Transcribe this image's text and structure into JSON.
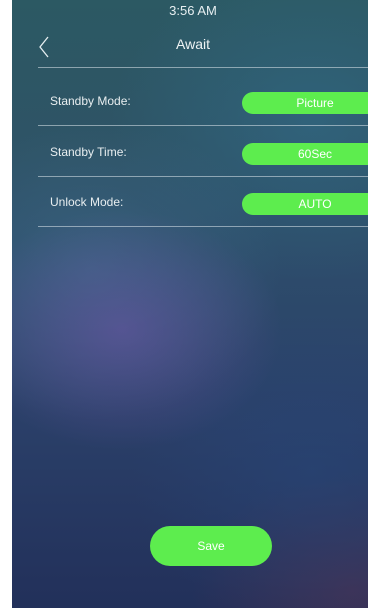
{
  "status_bar": {
    "time": "3:56 AM"
  },
  "header": {
    "title": "Await",
    "back_icon": "chevron-left-icon"
  },
  "settings": [
    {
      "label": "Standby Mode:",
      "value": "Picture"
    },
    {
      "label": "Standby Time:",
      "value": "60Sec"
    },
    {
      "label": "Unlock Mode:",
      "value": "AUTO"
    }
  ],
  "footer": {
    "save_label": "Save"
  },
  "colors": {
    "accent_green": "#5ded4e",
    "text": "#e8eef0"
  }
}
